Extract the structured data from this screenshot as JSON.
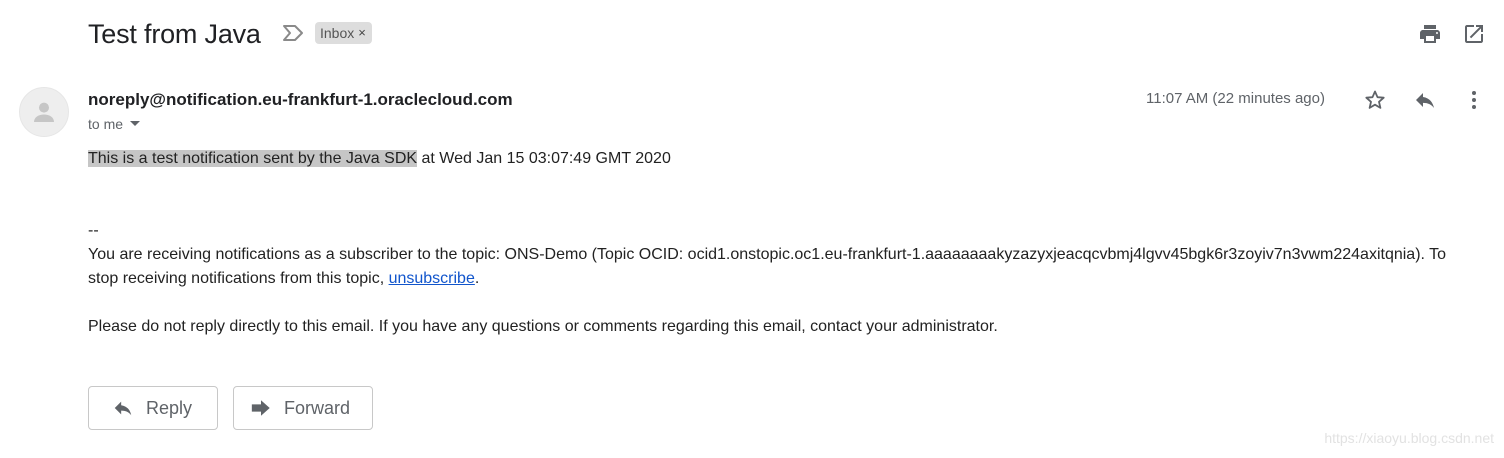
{
  "subject": "Test from Java",
  "label": {
    "name": "Inbox",
    "remove": "×"
  },
  "sender": "noreply@notification.eu-frankfurt-1.oraclecloud.com",
  "recipient": "to me",
  "time": "11:07 AM (22 minutes ago)",
  "body": {
    "highlighted": "This is a test notification sent by the Java SDK",
    "line1_rest": " at Wed Jan 15 03:07:49 GMT 2020",
    "separator": "--",
    "subscriber_line1": "You are receiving notifications as a subscriber to the topic: ONS-Demo (Topic OCID: ocid1.onstopic.oc1.eu-frankfurt-1.aaaaaaaakyzazyxjeacqcvbmj4lgvv45bgk6r3zoyiv7n3vwm224axitqnia). To",
    "subscriber_line2": "stop receiving notifications from this topic, ",
    "unsubscribe": "unsubscribe",
    "period": ".",
    "notice": "Please do not reply directly to this email. If you have any questions or comments regarding this email, contact your administrator."
  },
  "actions": {
    "reply": "Reply",
    "forward": "Forward"
  },
  "watermark": "https://xiaoyu.blog.csdn.net",
  "icons": [
    "importance-marker-icon",
    "print-icon",
    "open-in-new-window-icon",
    "avatar-icon",
    "dropdown-icon",
    "star-icon",
    "reply-icon",
    "more-vertical-icon",
    "forward-icon"
  ],
  "colors": {
    "link": "#1155cc",
    "highlight": "#c6c6c6",
    "chip": "#dddddd"
  }
}
